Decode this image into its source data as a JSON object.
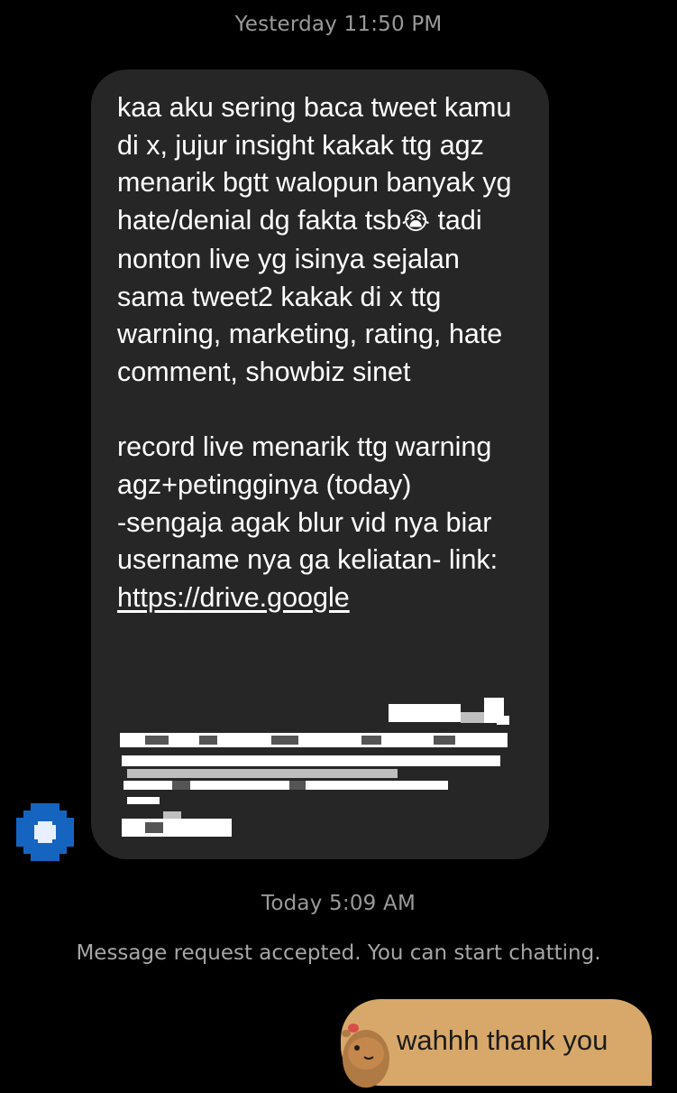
{
  "thread": {
    "timestamp_1": "Yesterday 11:50 PM",
    "timestamp_2": "Today 5:09 AM",
    "system_note": "Message request accepted. You can start chatting."
  },
  "incoming_message": {
    "paragraph_1_part_1": "kaa aku sering baca tweet kamu di x, jujur insight kakak ttg agz menarik bgtt walopun banyak yg hate/denial dg fakta tsb",
    "emoji": "😭",
    "paragraph_1_part_2": " tadi nonton live yg isinya sejalan sama tweet2 kakak di x ttg warning, marketing, rating, hate comment, showbiz sinet",
    "paragraph_2": "record live menarik ttg warning agz+petingginya (today)\n-sengaja agak blur vid nya biar username nya ga keliatan- link:",
    "link_visible": "https://drive.google"
  },
  "outgoing_message": {
    "text": "wahhh thank you"
  },
  "colors": {
    "background": "#000000",
    "incoming_bubble": "#262626",
    "outgoing_bubble": "#d8a86a",
    "timestamp_text": "#9a9a9a",
    "avatar_blue": "#1565c0"
  },
  "icons": {
    "avatar": "pixelated-avatar",
    "sticker": "capybara-sticker"
  }
}
